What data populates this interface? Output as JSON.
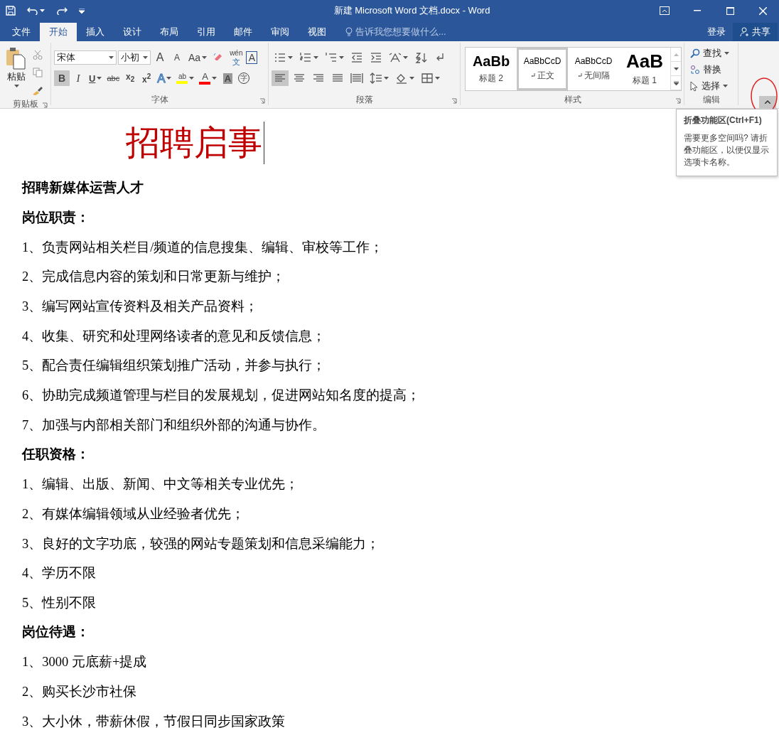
{
  "window": {
    "title": "新建 Microsoft Word 文档.docx - Word"
  },
  "tabs": [
    {
      "label": "文件",
      "selected": false
    },
    {
      "label": "开始",
      "selected": true
    },
    {
      "label": "插入",
      "selected": false
    },
    {
      "label": "设计",
      "selected": false
    },
    {
      "label": "布局",
      "selected": false
    },
    {
      "label": "引用",
      "selected": false
    },
    {
      "label": "邮件",
      "selected": false
    },
    {
      "label": "审阅",
      "selected": false
    },
    {
      "label": "视图",
      "selected": false
    }
  ],
  "tell_me": {
    "placeholder": "告诉我您想要做什么..."
  },
  "account": {
    "sign_in": "登录",
    "share": "共享"
  },
  "clipboard": {
    "label": "剪贴板",
    "paste": "粘贴"
  },
  "font": {
    "label": "字体",
    "name": "宋体",
    "size": "小初",
    "row1": [
      {
        "kind": "grow",
        "glyph": "A"
      },
      {
        "kind": "shrink",
        "glyph": "A"
      },
      {
        "kind": "case",
        "glyph": "Aa"
      },
      {
        "kind": "clear"
      },
      {
        "kind": "phonetic",
        "glyph": "wén",
        "glyph2": "文"
      },
      {
        "kind": "border",
        "glyph": "A"
      }
    ],
    "row2": [
      {
        "kind": "bold",
        "glyph": "B",
        "selected": true
      },
      {
        "kind": "italic",
        "glyph": "I",
        "selected": false
      },
      {
        "kind": "underline",
        "glyph": "U",
        "selected": false
      },
      {
        "kind": "strike",
        "glyph": "abc",
        "selected": false
      },
      {
        "kind": "sub",
        "glyph": "x$_{2}$",
        "selected": false
      },
      {
        "kind": "super",
        "glyph": "x$^{2}$",
        "selected": false
      },
      {
        "kind": "effects",
        "glyph": "A",
        "selected": false
      },
      {
        "kind": "highlight",
        "glyph": "ab",
        "color": "#ffff00",
        "selected": false
      },
      {
        "kind": "color",
        "glyph": "A",
        "color": "#ff0000",
        "selected": false
      },
      {
        "kind": "shade",
        "glyph": "A",
        "selected": false
      },
      {
        "kind": "enclose",
        "glyph": "字",
        "selected": false
      }
    ]
  },
  "paragraph": {
    "label": "段落",
    "align": [
      {
        "kind": "left",
        "selected": true
      },
      {
        "kind": "center",
        "selected": false
      },
      {
        "kind": "right",
        "selected": false
      },
      {
        "kind": "justify",
        "selected": false
      },
      {
        "kind": "distributed",
        "selected": false
      }
    ]
  },
  "styles": {
    "label": "样式",
    "items": [
      {
        "preview": "AaBb",
        "name": "标题 2",
        "kind": "heading2",
        "selected": false
      },
      {
        "preview": "AaBbCcD",
        "name": "正文",
        "kind": "body",
        "selected": true
      },
      {
        "preview": "AaBbCcD",
        "name": "无间隔",
        "kind": "body",
        "selected": false
      },
      {
        "preview": "AaB",
        "name": "标题 1",
        "kind": "heading1",
        "selected": false
      }
    ]
  },
  "editing": {
    "label": "编辑",
    "items": [
      {
        "kind": "find",
        "label": "查找"
      },
      {
        "kind": "replace",
        "label": "替换"
      },
      {
        "kind": "select",
        "label": "选择"
      }
    ]
  },
  "tooltip": {
    "title": "折叠功能区(Ctrl+F1)",
    "text": "需要更多空间吗? 请折叠功能区，以便仅显示选项卡名称。"
  },
  "document": {
    "title": "招聘启事",
    "paragraphs": [
      {
        "kind": "heading",
        "text": "招聘新媒体运营人才"
      },
      {
        "kind": "heading",
        "text": "岗位职责："
      },
      {
        "kind": "item",
        "text": "1、负责网站相关栏目/频道的信息搜集、编辑、审校等工作；"
      },
      {
        "kind": "item",
        "text": "2、完成信息内容的策划和日常更新与维护；"
      },
      {
        "kind": "item",
        "text": "3、编写网站宣传资料及相关产品资料；"
      },
      {
        "kind": "item",
        "text": "4、收集、研究和处理网络读者的意见和反馈信息；"
      },
      {
        "kind": "item",
        "text": "5、配合责任编辑组织策划推广活动，并参与执行；"
      },
      {
        "kind": "item",
        "text": "6、协助完成频道管理与栏目的发展规划，促进网站知名度的提高；"
      },
      {
        "kind": "item",
        "text": "7、加强与内部相关部门和组织外部的沟通与协作。"
      },
      {
        "kind": "heading",
        "text": "任职资格："
      },
      {
        "kind": "item",
        "text": "1、编辑、出版、新闻、中文等相关专业优先；"
      },
      {
        "kind": "item",
        "text": "2、有媒体编辑领域从业经验者优先；"
      },
      {
        "kind": "item",
        "text": "3、良好的文字功底，较强的网站专题策划和信息采编能力；"
      },
      {
        "kind": "item",
        "text": "4、学历不限"
      },
      {
        "kind": "item",
        "text": "5、性别不限"
      },
      {
        "kind": "heading",
        "text": "岗位待遇："
      },
      {
        "kind": "item",
        "text": "1、3000 元底薪+提成"
      },
      {
        "kind": "item",
        "text": "2、购买长沙市社保"
      },
      {
        "kind": "item",
        "text": "3、大小休，带薪休假，节假日同步国家政策"
      }
    ]
  }
}
